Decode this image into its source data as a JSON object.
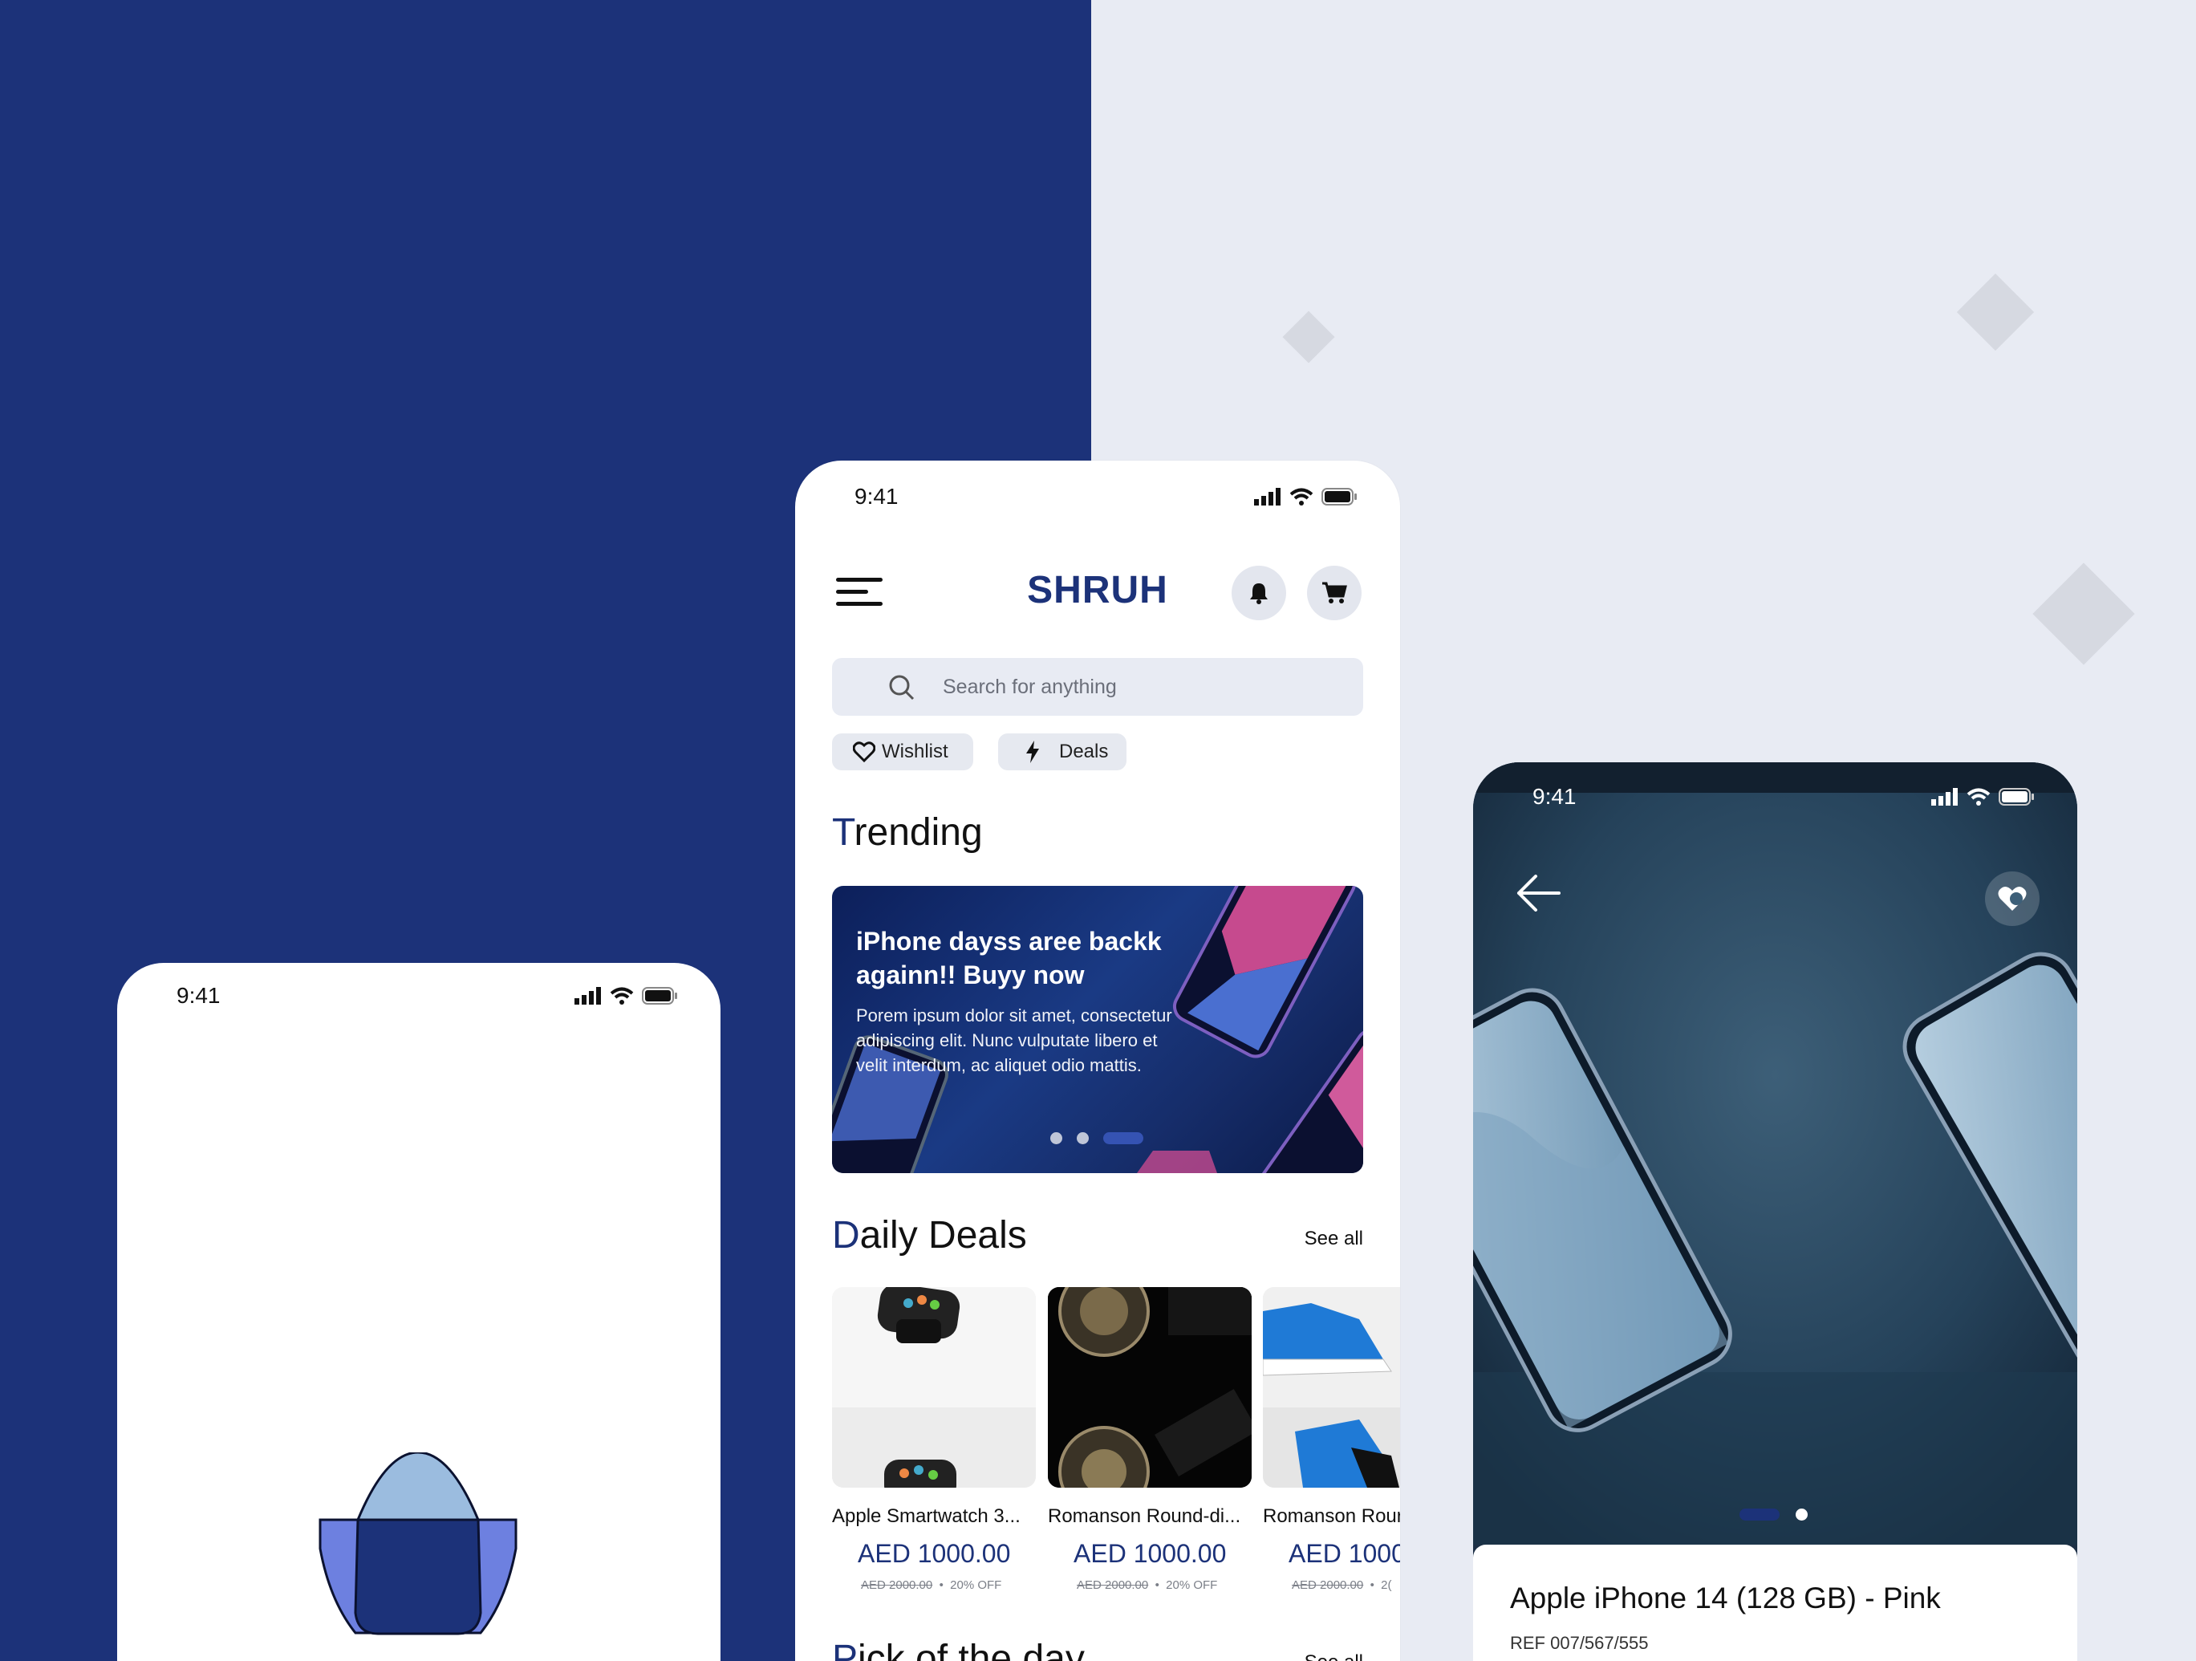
{
  "status": {
    "time": "9:41"
  },
  "home": {
    "brand": "SHRUH",
    "search_placeholder": "Search for anything",
    "chips": [
      "Wishlist",
      "Deals"
    ],
    "trending": {
      "title_first": "T",
      "title_rest": "rending"
    },
    "banner": {
      "headline": "iPhone dayss aree backk againn!! Buyy now",
      "body": "Porem ipsum dolor sit amet, consectetur adipiscing elit. Nunc vulputate libero et velit interdum, ac aliquet odio mattis.",
      "slide_count": 3,
      "active_slide": 3
    },
    "daily_deals": {
      "title_first": "D",
      "title_rest": "aily Deals",
      "see_all": "See all"
    },
    "products": [
      {
        "name": "Apple Smartwatch 3...",
        "price": "AED  1000.00",
        "old_price": "AED  2000.00",
        "discount": "20% OFF",
        "image": "smartwatch"
      },
      {
        "name": "Romanson Round-di...",
        "price": "AED  1000.00",
        "old_price": "AED  2000.00",
        "discount": "20% OFF",
        "image": "watch-movement"
      },
      {
        "name": "Romanson Rour",
        "price": "AED  1000",
        "old_price": "AED  2000.00",
        "discount": "2(",
        "image": "sneakers"
      }
    ],
    "pick_of_day": {
      "title_first": "P",
      "title_rest": "ick of the day",
      "see_all": "See all"
    }
  },
  "detail": {
    "product_title": "Apple iPhone 14 (128 GB) - Pink",
    "ref": "REF 007/567/555",
    "gallery_count": 2,
    "gallery_active": 1
  },
  "colors": {
    "brand_navy": "#1c3279",
    "bg_light": "#e8ebf3",
    "logo_light": "#9bbcdf",
    "logo_side": "#6d80e0"
  }
}
